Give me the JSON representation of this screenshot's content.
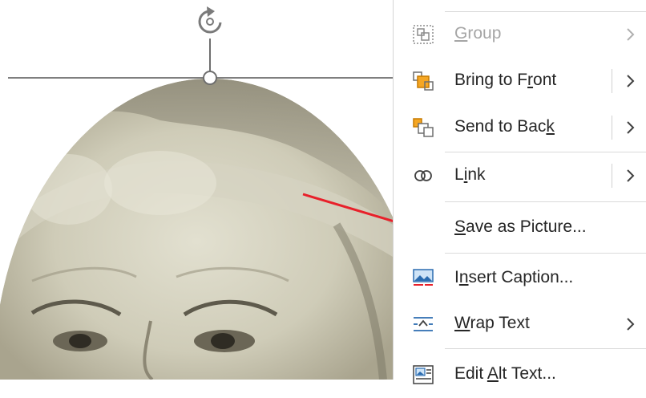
{
  "menu": {
    "items": [
      {
        "id": "group",
        "icon": "group-icon",
        "pre": "",
        "u": "G",
        "post": "roup",
        "disabled": true,
        "submenu": true,
        "split": false
      },
      {
        "id": "bring-to-front",
        "icon": "bring-to-front-icon",
        "pre": "Bring to F",
        "u": "r",
        "post": "ont",
        "disabled": false,
        "submenu": true,
        "split": true
      },
      {
        "id": "send-to-back",
        "icon": "send-to-back-icon",
        "pre": "Send to Bac",
        "u": "k",
        "post": "",
        "disabled": false,
        "submenu": true,
        "split": true
      },
      {
        "id": "link",
        "icon": "link-icon",
        "pre": "L",
        "u": "i",
        "post": "nk",
        "disabled": false,
        "submenu": true,
        "split": true
      },
      {
        "id": "save-as-picture",
        "icon": "",
        "pre": "",
        "u": "S",
        "post": "ave as Picture...",
        "disabled": false,
        "submenu": false,
        "split": false
      },
      {
        "id": "insert-caption",
        "icon": "insert-caption-icon",
        "pre": "I",
        "u": "n",
        "post": "sert Caption...",
        "disabled": false,
        "submenu": false,
        "split": false
      },
      {
        "id": "wrap-text",
        "icon": "wrap-text-icon",
        "pre": "",
        "u": "W",
        "post": "rap Text",
        "disabled": false,
        "submenu": true,
        "split": false
      },
      {
        "id": "edit-alt-text",
        "icon": "edit-alt-text-icon",
        "pre": "Edit ",
        "u": "A",
        "post": "lt Text...",
        "disabled": false,
        "submenu": false,
        "split": false
      }
    ]
  },
  "colors": {
    "arrow": "#e8202a",
    "menu_text": "#262626",
    "disabled_text": "#a6a6a6",
    "selection_line": "#7f7f7f"
  }
}
